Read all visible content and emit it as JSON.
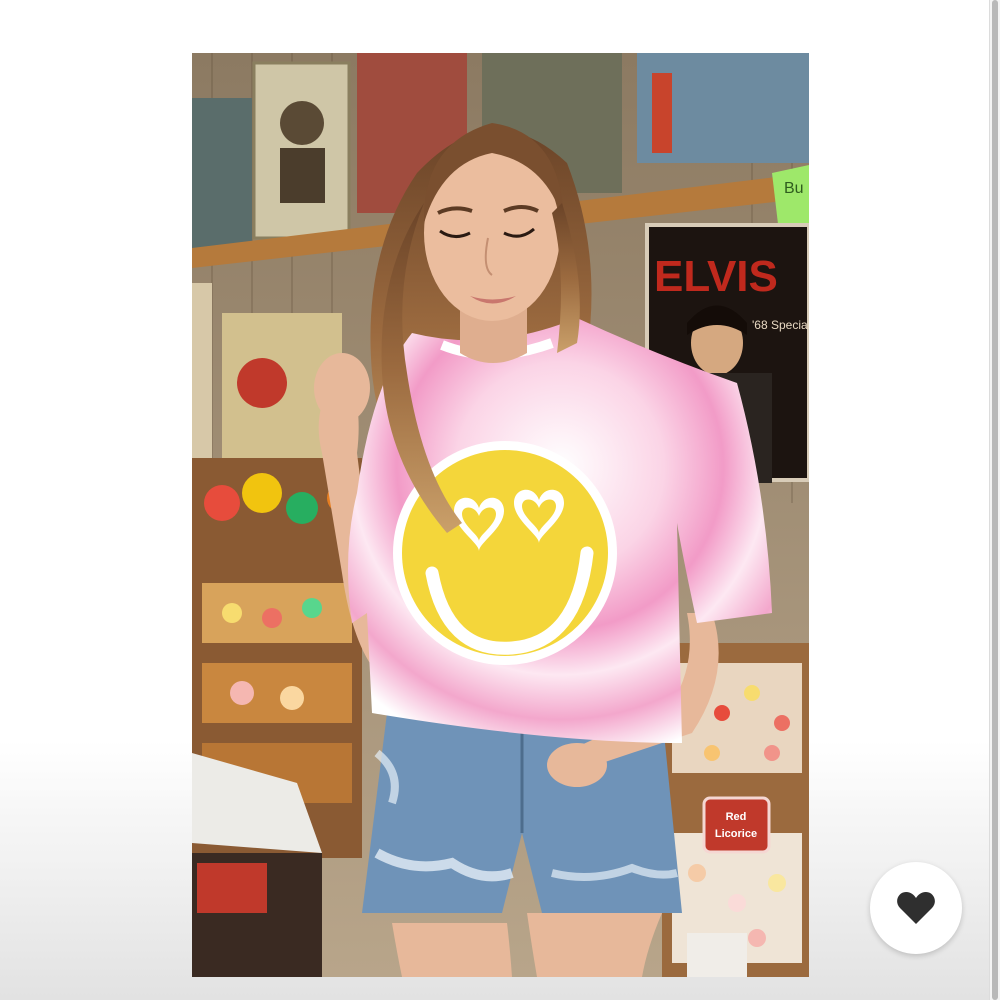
{
  "product": {
    "image_alt": "Model wearing a pink tie-dye tee with a yellow heart-eyes smiley face and denim shorts in a candy shop",
    "poster_text": "ELVIS",
    "poster_subtext": "'68 Special",
    "candy_sign": [
      "Red",
      "Licorice"
    ],
    "sticky_note": "Bu"
  },
  "actions": {
    "like_icon": "heart-icon"
  },
  "colors": {
    "tee_pink": "#f29bc7",
    "smiley_yellow": "#f4d63a",
    "denim": "#6f93b8",
    "like_heart": "#2f2f2f"
  }
}
